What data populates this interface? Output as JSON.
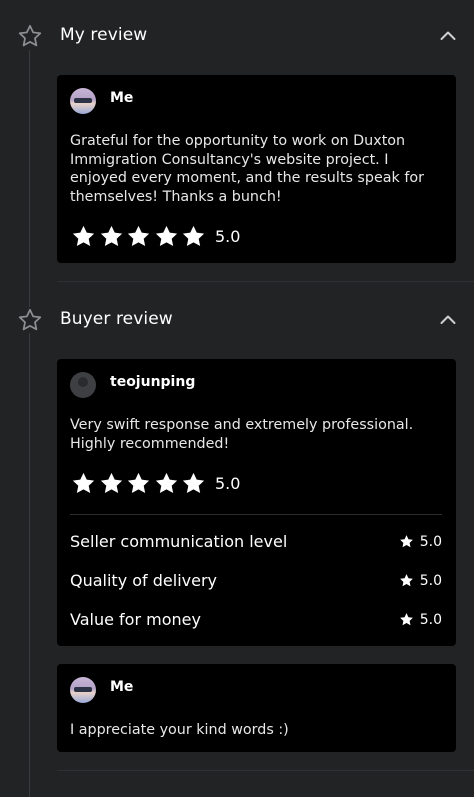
{
  "my_review": {
    "title": "My review",
    "user": "Me",
    "text": "Grateful for the opportunity to work on Duxton Immigration Consultancy's website project. I enjoyed every moment, and the results speak for themselves! Thanks a bunch!",
    "stars": 5,
    "rating": "5.0"
  },
  "buyer_review": {
    "title": "Buyer review",
    "user": "teojunping",
    "text": "Very swift response and extremely professional. Highly recommended!",
    "stars": 5,
    "rating": "5.0",
    "breakdown": [
      {
        "label": "Seller communication level",
        "score": "5.0"
      },
      {
        "label": "Quality of delivery",
        "score": "5.0"
      },
      {
        "label": "Value for money",
        "score": "5.0"
      }
    ]
  },
  "reply": {
    "user": "Me",
    "text": "I appreciate your kind words :)"
  },
  "colors": {
    "background": "#222325",
    "card": "#000000",
    "star": "#ffffff",
    "outline_star": "#8e8f93"
  },
  "icons": {
    "section_icon": "star-outline-icon",
    "collapse_icon": "chevron-up-icon",
    "rating_icon": "star-icon"
  }
}
